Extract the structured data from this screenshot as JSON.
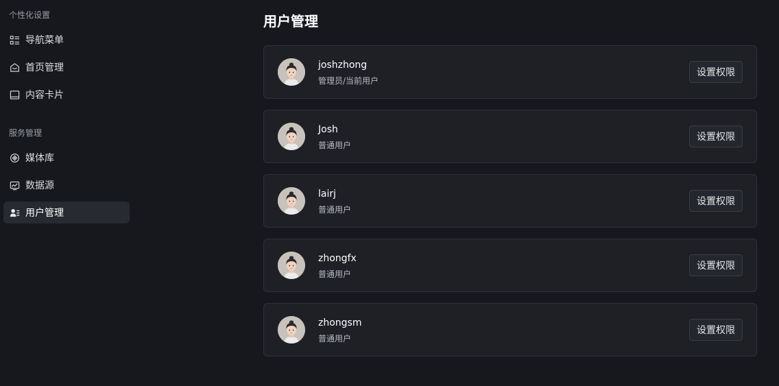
{
  "sidebar": {
    "sections": [
      {
        "title": "个性化设置",
        "items": [
          {
            "label": "导航菜单",
            "icon": "menu-list-icon"
          },
          {
            "label": "首页管理",
            "icon": "home-icon"
          },
          {
            "label": "内容卡片",
            "icon": "card-icon"
          }
        ]
      },
      {
        "title": "服务管理",
        "items": [
          {
            "label": "媒体库",
            "icon": "media-library-icon"
          },
          {
            "label": "数据源",
            "icon": "data-source-icon"
          },
          {
            "label": "用户管理",
            "icon": "user-manage-icon",
            "active": true
          }
        ]
      }
    ]
  },
  "main": {
    "title": "用户管理",
    "users": [
      {
        "name": "joshzhong",
        "role": "管理员/当前用户",
        "button": "设置权限"
      },
      {
        "name": "Josh",
        "role": "普通用户",
        "button": "设置权限"
      },
      {
        "name": "lairj",
        "role": "普通用户",
        "button": "设置权限"
      },
      {
        "name": "zhongfx",
        "role": "普通用户",
        "button": "设置权限"
      },
      {
        "name": "zhongsm",
        "role": "普通用户",
        "button": "设置权限"
      }
    ]
  },
  "colors": {
    "background": "#16181d",
    "card": "#1e2026",
    "active_nav": "#272a31"
  }
}
